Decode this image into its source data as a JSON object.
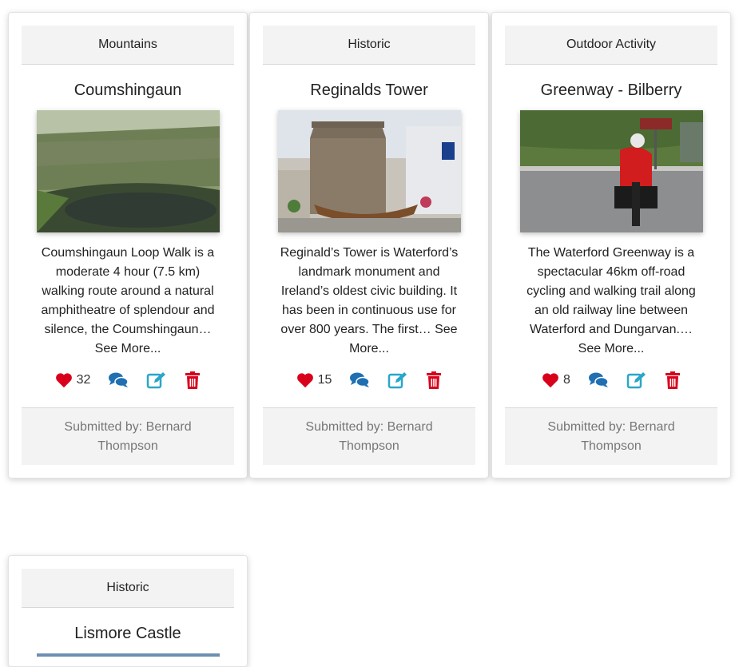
{
  "cards": [
    {
      "category": "Mountains",
      "title": "Coumshingaun",
      "image_alt": "Coumshingaun lake photo",
      "description": "Coumshingaun Loop Walk is a moderate 4 hour (7.5 km) walking route around a natural amphitheatre of splendour and silence, the Coumshingaun…",
      "see_more": "See More...",
      "likes": "32",
      "submitted_by": "Submitted by: Bernard Thompson"
    },
    {
      "category": "Historic",
      "title": "Reginalds Tower",
      "image_alt": "Reginalds Tower photo",
      "description": "Reginald’s Tower is Waterford’s landmark monument and Ireland’s oldest civic building. It has been in continuous use for over 800 years. The first…",
      "see_more": "See More...",
      "likes": "15",
      "submitted_by": "Submitted by: Bernard Thompson"
    },
    {
      "category": "Outdoor Activity",
      "title": "Greenway - Bilberry",
      "image_alt": "Greenway cyclist photo",
      "description": "The Waterford Greenway is a spectacular 46km off-road cycling and walking trail along an old railway line between Waterford and Dungarvan.…",
      "see_more": "See More...",
      "likes": "8",
      "submitted_by": "Submitted by: Bernard Thompson"
    },
    {
      "category": "Historic",
      "title": "Lismore Castle"
    }
  ],
  "colors": {
    "heart": "#d9001b",
    "comment": "#1f6fb2",
    "edit": "#2aa6c9",
    "delete": "#d9001b"
  },
  "icons": [
    "heart-icon",
    "comments-icon",
    "edit-icon",
    "trash-icon"
  ]
}
